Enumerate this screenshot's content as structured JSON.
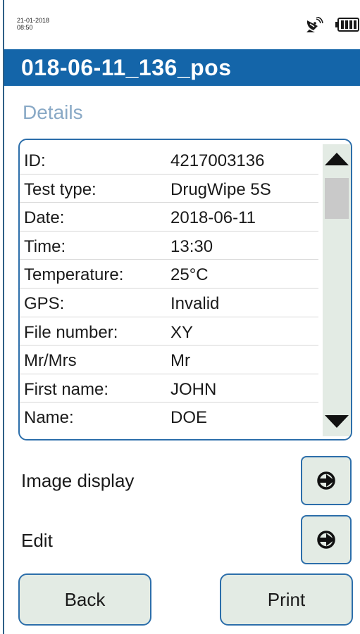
{
  "status": {
    "date": "21-01-2018",
    "time": "08:50",
    "gps_icon": "satellite-dish-icon",
    "battery_icon": "battery-full-icon"
  },
  "header": {
    "title": "018-06-11_136_pos"
  },
  "section": {
    "heading": "Details"
  },
  "details": [
    {
      "label": "ID:",
      "value": "4217003136"
    },
    {
      "label": "Test type:",
      "value": "DrugWipe 5S"
    },
    {
      "label": "Date:",
      "value": "2018-06-11"
    },
    {
      "label": "Time:",
      "value": "13:30"
    },
    {
      "label": "Temperature:",
      "value": "25°C"
    },
    {
      "label": "GPS:",
      "value": "Invalid"
    },
    {
      "label": "File number:",
      "value": "XY"
    },
    {
      "label": "Mr/Mrs",
      "value": "Mr"
    },
    {
      "label": "First name:",
      "value": "JOHN"
    },
    {
      "label": "Name:",
      "value": "DOE"
    }
  ],
  "options": {
    "image_display": "Image display",
    "edit": "Edit"
  },
  "buttons": {
    "back": "Back",
    "print": "Print"
  },
  "colors": {
    "title_bar": "#1465a9",
    "accent_border": "#2c6eaa",
    "button_fill": "#e3ebe4",
    "heading_text": "#89a9c6"
  }
}
